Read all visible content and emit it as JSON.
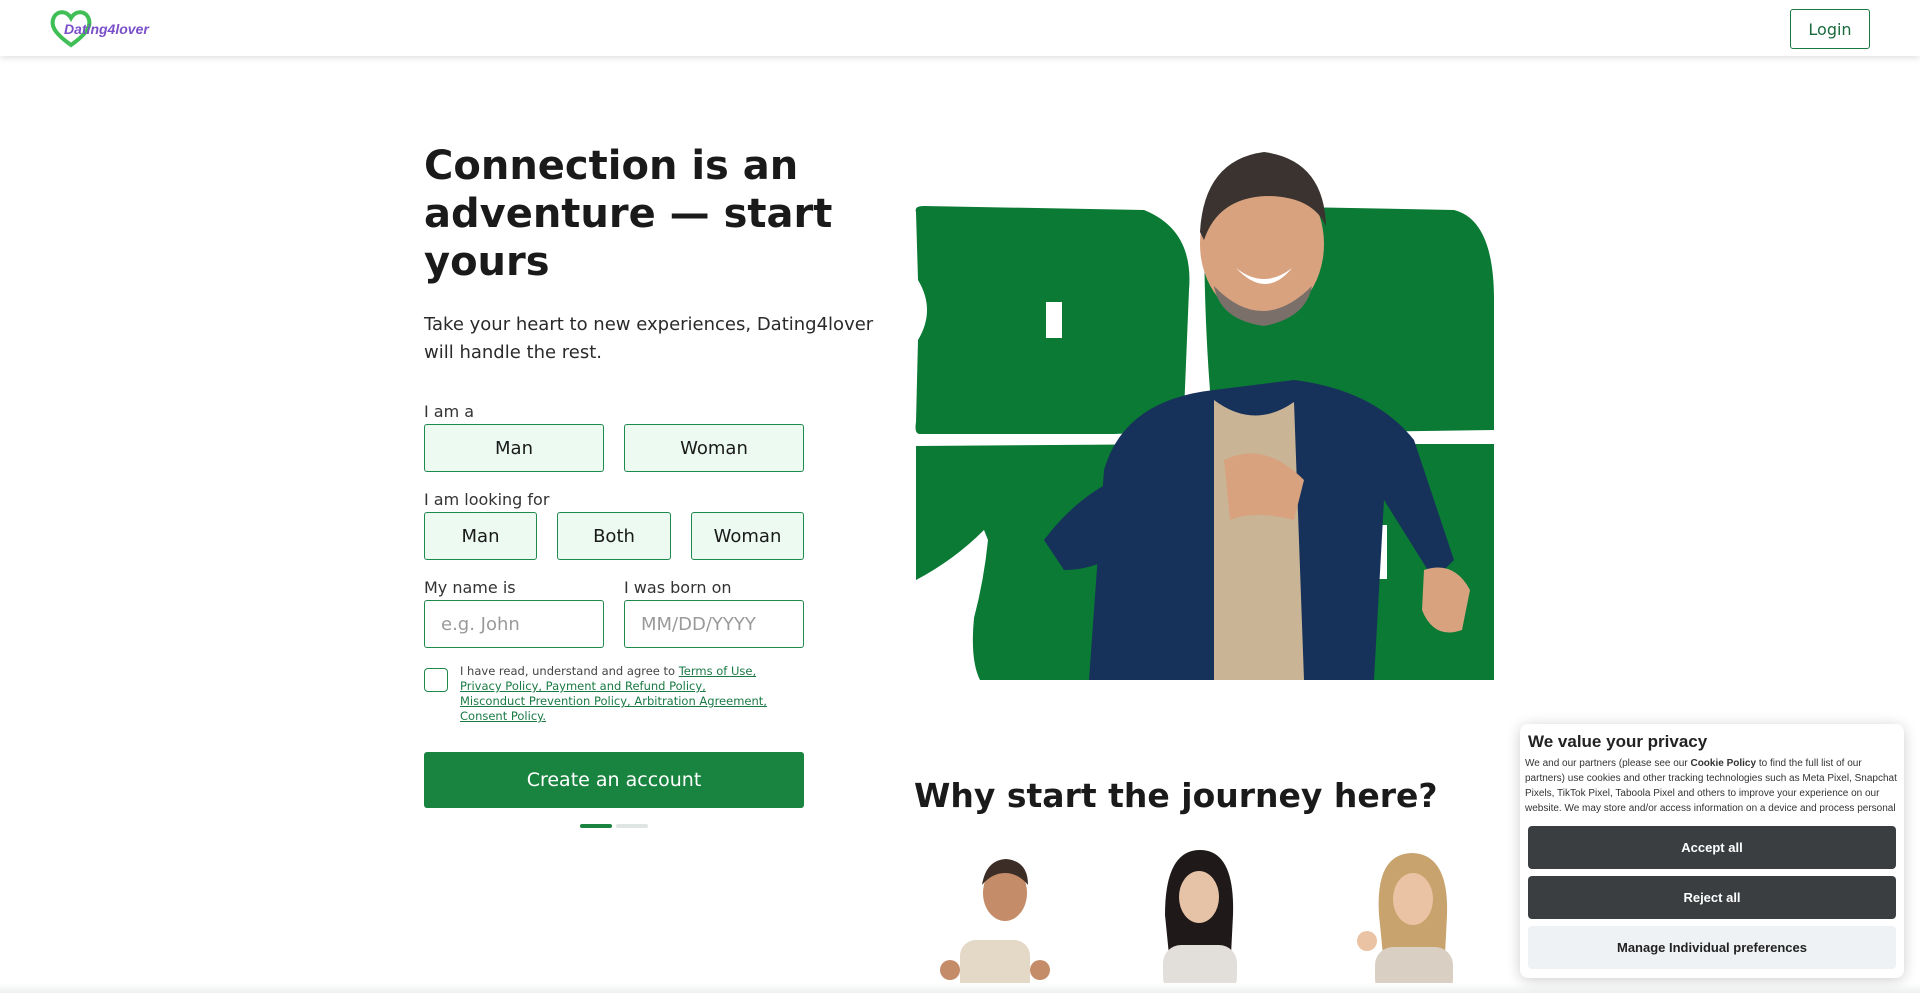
{
  "header": {
    "logo_text": "Dating4lover",
    "login_label": "Login"
  },
  "hero": {
    "title": "Connection is an adventure — start yours",
    "subtitle": "Take your heart to new experiences, Dating4lover will handle the rest."
  },
  "form": {
    "gender_label": "I am a",
    "gender_options": [
      "Man",
      "Woman"
    ],
    "seeking_label": "I am looking for",
    "seeking_options": [
      "Man",
      "Both",
      "Woman"
    ],
    "name_label": "My name is",
    "name_placeholder": "e.g. John",
    "born_label": "I was born on",
    "born_placeholder": "MM/DD/YYYY",
    "terms_prefix": "I have read, understand and agree to",
    "terms_links": [
      "Terms of Use,",
      "Privacy Policy, Payment and Refund Policy,",
      "Misconduct Prevention Policy, Arbitration Agreement,",
      "Consent Policy."
    ],
    "create_label": "Create an account",
    "step_current": 1,
    "step_total": 2
  },
  "why": {
    "title": "Why start the journey here?"
  },
  "cookie": {
    "title": "We value your privacy",
    "text_before": "We and our partners (please see our",
    "text_bold": "Cookie Policy",
    "text_after": "to find the full list of our partners) use cookies and other tracking technologies such as Meta Pixel, Snapchat Pixels, TikTok Pixel, Taboola Pixel and others to improve your experience on our website. We may store and/or access information on a device and process personal",
    "accept_label": "Accept all",
    "reject_label": "Reject all",
    "manage_label": "Manage Individual preferences"
  },
  "colors": {
    "brand_green": "#19843f",
    "choice_bg": "#ecfaf2",
    "logo_purple": "#7a4fc9",
    "cookie_dark": "#3a3e41"
  }
}
